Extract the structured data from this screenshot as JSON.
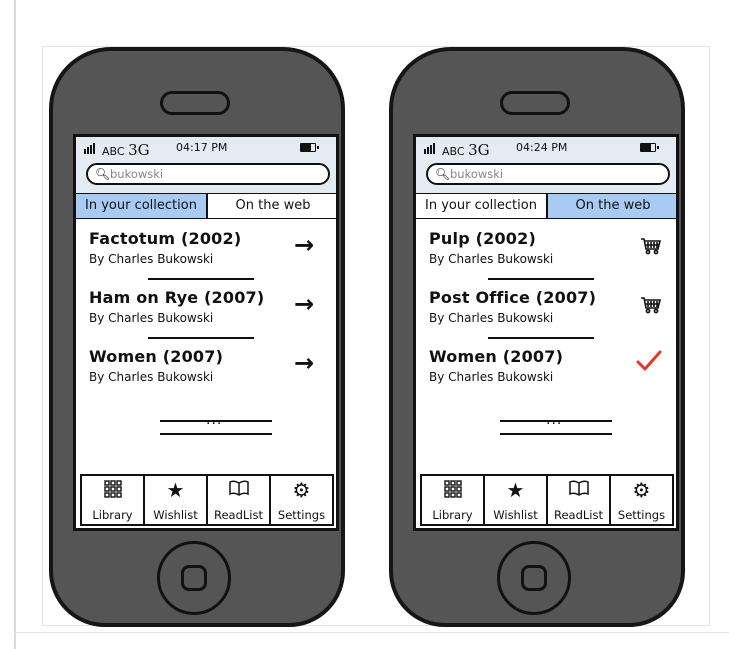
{
  "phones": [
    {
      "status": {
        "carrier": "ABC",
        "network": "3G",
        "time": "04:17 PM"
      },
      "search": {
        "value": "bukowski"
      },
      "tabs": [
        {
          "label": "In your collection",
          "active": true
        },
        {
          "label": "On the web",
          "active": false
        }
      ],
      "results": [
        {
          "title": "Factotum (2002)",
          "author": "By Charles Bukowski",
          "action_icon": "arrow-right-icon"
        },
        {
          "title": "Ham on Rye (2007)",
          "author": "By Charles Bukowski",
          "action_icon": "arrow-right-icon"
        },
        {
          "title": "Women (2007)",
          "author": "By Charles Bukowski",
          "action_icon": "arrow-right-icon"
        }
      ],
      "more": "...",
      "tabbar": [
        {
          "label": "Library",
          "icon": "grid-icon"
        },
        {
          "label": "Wishlist",
          "icon": "star-icon"
        },
        {
          "label": "ReadList",
          "icon": "book-icon"
        },
        {
          "label": "Settings",
          "icon": "gear-icon"
        }
      ]
    },
    {
      "status": {
        "carrier": "ABC",
        "network": "3G",
        "time": "04:24 PM"
      },
      "search": {
        "value": "bukowski"
      },
      "tabs": [
        {
          "label": "In your collection",
          "active": false
        },
        {
          "label": "On the web",
          "active": true
        }
      ],
      "results": [
        {
          "title": "Pulp (2002)",
          "author": "By Charles Bukowski",
          "action_icon": "cart-icon"
        },
        {
          "title": "Post Office (2007)",
          "author": "By Charles Bukowski",
          "action_icon": "cart-icon"
        },
        {
          "title": "Women (2007)",
          "author": "By Charles Bukowski",
          "action_icon": "checkmark-icon"
        }
      ],
      "more": "...",
      "tabbar": [
        {
          "label": "Library",
          "icon": "grid-icon"
        },
        {
          "label": "Wishlist",
          "icon": "star-icon"
        },
        {
          "label": "ReadList",
          "icon": "book-icon"
        },
        {
          "label": "Settings",
          "icon": "gear-icon"
        }
      ]
    }
  ],
  "colors": {
    "phone_body": "#555555",
    "status_bar": "#e4ebf2",
    "active_tab": "#a9caf2",
    "check": "#e23a2a"
  }
}
